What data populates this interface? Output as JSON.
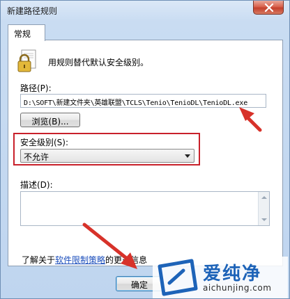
{
  "window": {
    "title": "新建路径规则"
  },
  "tabs": [
    {
      "label": "常规"
    }
  ],
  "rule": {
    "description": "用规则替代默认安全级别。",
    "path_label": "路径(P):",
    "path_value": "D:\\SOFT\\新建文件夹\\英雄联盟\\TCLS\\Tenio\\TenioDL\\TenioDL.exe",
    "browse_label": "浏览(B)...",
    "security_label": "安全级别(S):",
    "security_value": "不允许",
    "description_label": "描述(D):",
    "description_value": ""
  },
  "footer": {
    "learn_prefix": "了解关于",
    "learn_link": "软件限制策略",
    "learn_suffix": "的更多信息",
    "ok_label": "确定"
  },
  "watermark": {
    "text": "爱纯净",
    "url": "aichunjing.com"
  },
  "colors": {
    "highlight": "#c8202a",
    "link": "#1a4dbb",
    "brand": "#1d63b8"
  }
}
